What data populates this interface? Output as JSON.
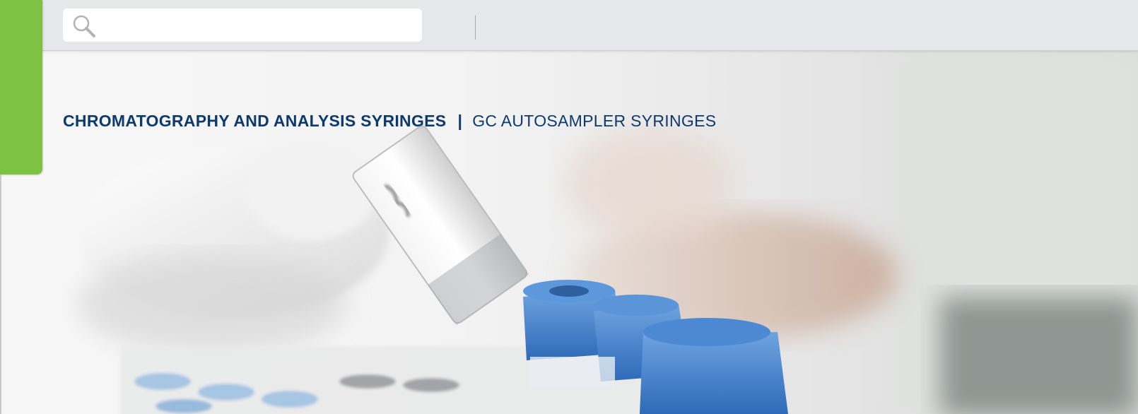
{
  "search": {
    "value": "",
    "placeholder": ""
  },
  "heading": {
    "category": "CHROMATOGRAPHY AND ANALYSIS SYRINGES",
    "separator": "|",
    "subcategory": "GC AUTOSAMPLER SYRINGES"
  },
  "icons": {
    "search": "search-icon"
  },
  "colors": {
    "toolbar_bg": "#e6e7e8",
    "side_tab": "#7dc242",
    "heading_text": "#0d3a6e",
    "vial_cap": "#3f7fcf"
  }
}
